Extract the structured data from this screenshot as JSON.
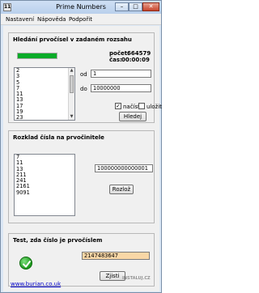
{
  "window": {
    "title": "Prime Numbers",
    "icon_glyph": "11",
    "minimize": "–",
    "maximize": "□",
    "close": "✕"
  },
  "menu": [
    "Nastavení",
    "Nápověda",
    "Podpořit"
  ],
  "search": {
    "title": "Hledání prvočísel v zadaném rozsahu",
    "progress_fraction": 1.0,
    "progress_color": "#0aab28",
    "count_label": "počet:",
    "count_value": "664579",
    "time_label": "čas:",
    "time_value": "00:00:09",
    "results": [
      "2",
      "3",
      "5",
      "7",
      "11",
      "13",
      "17",
      "19",
      "23"
    ],
    "from_label": "od",
    "from_value": "1",
    "to_label": "do",
    "to_value": "10000000",
    "load_label": "načíst",
    "load_checked": true,
    "save_label": "uložit",
    "save_checked": false,
    "search_button": "Hledej"
  },
  "factor": {
    "title": "Rozklad čísla na prvočinitele",
    "factors": [
      "7",
      "11",
      "13",
      "211",
      "241",
      "2161",
      "9091"
    ],
    "input_value": "100000000000001",
    "button": "Rozlož"
  },
  "test": {
    "title": "Test, zda číslo je prvočíslem",
    "input_value": "2147483647",
    "input_color": "#f9d7a6",
    "result_icon": "check-icon",
    "button": "Zjisti"
  },
  "footer_link": "www.burian.co.uk",
  "watermark": "INSTALUJ.CZ"
}
